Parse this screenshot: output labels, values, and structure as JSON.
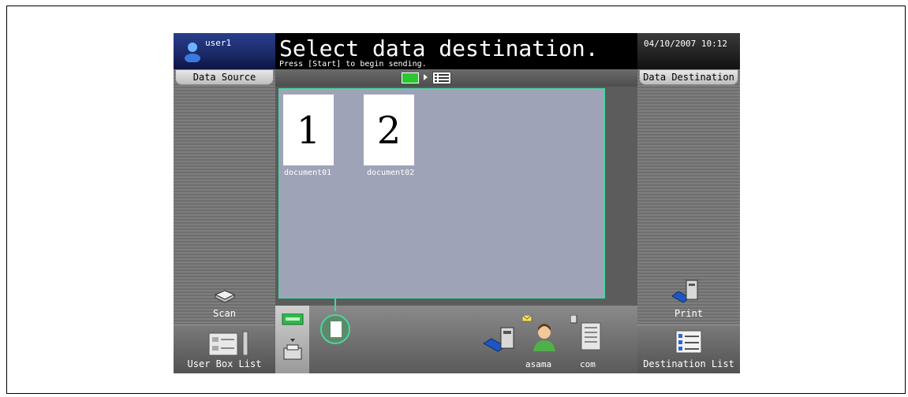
{
  "header": {
    "user_name": "user1",
    "title": "Select data destination.",
    "subtitle": "Press [Start] to begin sending.",
    "datetime": "04/10/2007  10:12"
  },
  "left_panel": {
    "heading": "Data Source",
    "scan_label": "Scan",
    "user_box_list_label": "User Box List"
  },
  "right_panel": {
    "heading": "Data Destination",
    "print_label": "Print",
    "destination_list_label": "Destination List"
  },
  "documents": [
    {
      "number": "1",
      "name": "document01"
    },
    {
      "number": "2",
      "name": "document02"
    }
  ],
  "destinations": [
    {
      "name": "asama",
      "icon": "person-with-mail-icon"
    },
    {
      "name": "com",
      "icon": "server-icon"
    }
  ],
  "colors": {
    "accent": "#4ad6a2",
    "doc_area": "#9ea3b8",
    "header_user_bg": "#1a2866"
  }
}
